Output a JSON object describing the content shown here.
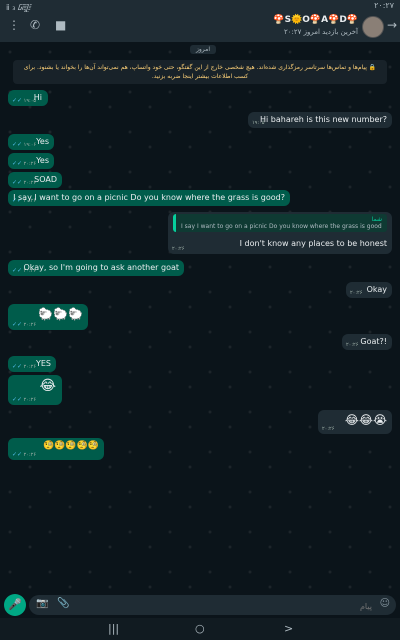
{
  "status": {
    "left": "ⅱ ₃ ᳄",
    "right": "۲۰:۲۷"
  },
  "header": {
    "title": "🍄S🌞O🍄A🍄D🍄",
    "subtitle": "آخرین بازدید امروز ۲۰:۲۷"
  },
  "chat": {
    "date_chip": "امروز",
    "system_note": "🔒 پیام‌ها و تماس‌ها سرتاسر رمزگذاری شده‌اند. هیچ شخصی خارج از این گفتگو، حتی خود واتساپ، هم نمی‌تواند آن‌ها را بخواند یا بشنود. برای کسب اطلاعات بیشتر اینجا ضربه بزنید.",
    "messages": [
      {
        "text": "Hi",
        "time": "۱۹:۰۵"
      },
      {
        "text": "Hi bahareh is this new number?",
        "time": "۱۹:۰۵"
      },
      {
        "text": "Yes",
        "time": "۱۹:۰۶"
      },
      {
        "text": "Yes",
        "time": "۲۰:۲۶"
      },
      {
        "text": "SOAD",
        "time": "۲۰:۲۶"
      },
      {
        "text": "I say I want to go on a picnic Do you know where the grass is good?",
        "time": "۲۰:۲۶"
      },
      {
        "reply_author": "شما",
        "reply_text": "I say I want to go on a picnic Do you know where the grass is good?",
        "text": "I don't know any places to be honest",
        "time": "۲۰:۲۶"
      },
      {
        "text": "Okay, so I'm going to ask another goat",
        "time": "۲۰:۲۶"
      },
      {
        "text": "Okay",
        "time": "۲۰:۲۶"
      },
      {
        "text": "🐑🐑🐑",
        "time": "۲۰:۲۶"
      },
      {
        "text": "Goat?!",
        "time": "۲۰:۲۶"
      },
      {
        "text": "YES",
        "time": "۲۰:۲۶"
      },
      {
        "text": "😂",
        "time": "۲۰:۲۶"
      },
      {
        "text": "😂😂😭",
        "time": "۲۰:۲۶"
      },
      {
        "text": "🧐🧐🧐🧐🧐",
        "time": "۲۰:۲۶"
      }
    ]
  },
  "input": {
    "placeholder": "پیام"
  },
  "icons": {
    "menu": "⋮",
    "call": "✆",
    "video": "■",
    "back": "→",
    "mic": "🎤",
    "camera": "📷",
    "attach": "📎",
    "emoji": "☺"
  }
}
